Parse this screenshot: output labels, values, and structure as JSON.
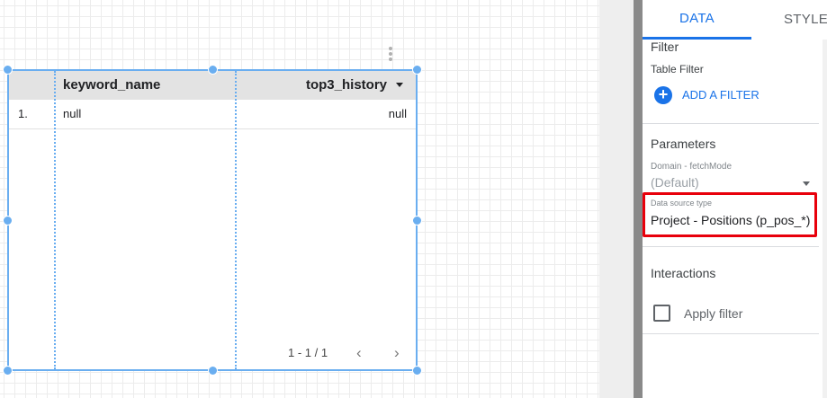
{
  "table": {
    "columns": [
      "keyword_name",
      "top3_history"
    ],
    "rows": [
      {
        "index": "1.",
        "keyword_name": "null",
        "top3_history": "null"
      }
    ],
    "pagination": "1 - 1 / 1",
    "prev_icon": "chevron-left-icon",
    "next_icon": "chevron-right-icon",
    "sort_icon": "sort-desc-icon"
  },
  "panel": {
    "tabs": [
      {
        "label": "DATA",
        "active": true
      },
      {
        "label": "STYLE",
        "active": false
      }
    ],
    "filter": {
      "section_title": "Filter",
      "table_filter_label": "Table Filter",
      "add_filter_label": "ADD A FILTER"
    },
    "parameters": {
      "section_title": "Parameters",
      "domain_label": "Domain - fetchMode",
      "domain_value": "(Default)",
      "source_label": "Data source type",
      "source_value": "Project - Positions (p_pos_*)"
    },
    "interactions": {
      "section_title": "Interactions",
      "apply_filter_label": "Apply filter",
      "apply_filter_checked": false
    }
  },
  "colors": {
    "accent": "#1a73e8",
    "selection": "#6aaef0",
    "highlight": "#e8000b"
  }
}
